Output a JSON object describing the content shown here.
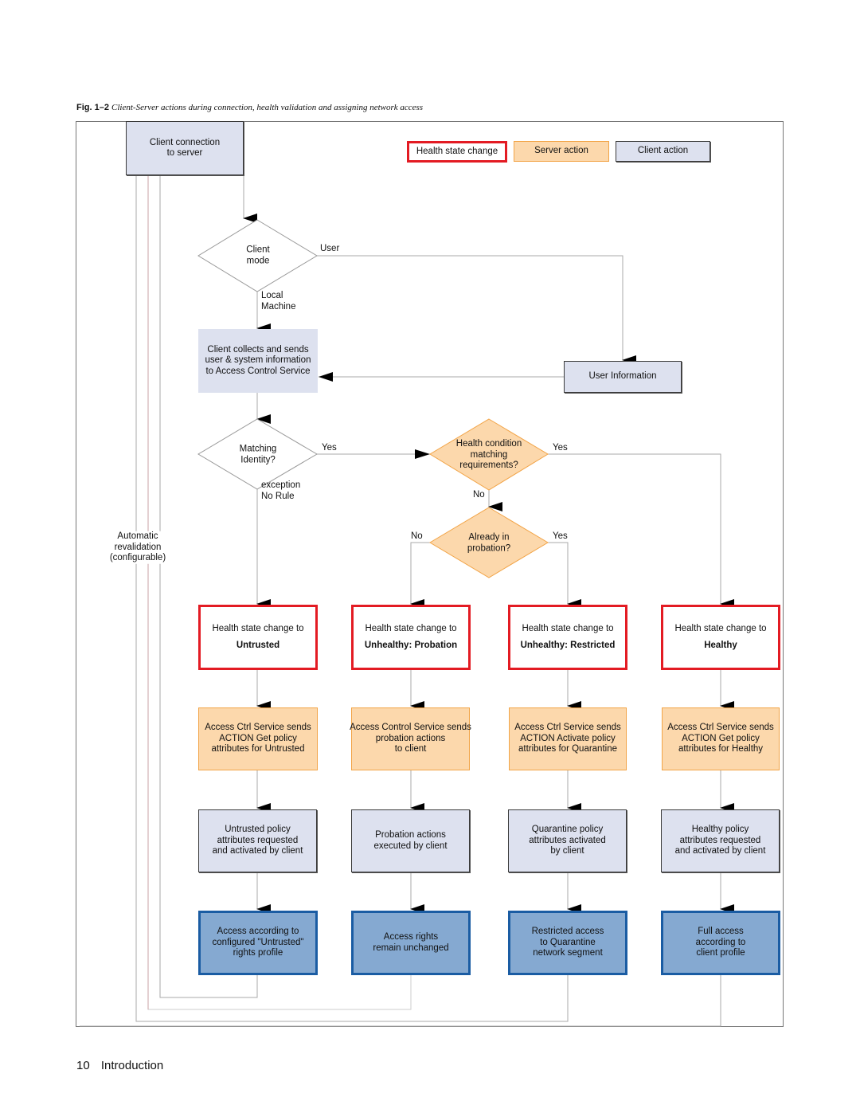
{
  "caption": {
    "figure": "Fig. 1–2",
    "text": "Client-Server actions during connection, health validation and assigning network access"
  },
  "legend": {
    "health_state_change": "Health state change",
    "server_action": "Server action",
    "client_action": "Client action"
  },
  "colors": {
    "health_border": "#e31b23",
    "server_fill": "#fcd8ac",
    "server_border": "#f2a447",
    "client_fill": "#dde1ef",
    "access_fill": "#85a9d1",
    "access_border": "#1a5ca3"
  },
  "nodes": {
    "start": "Client connection\nto server",
    "client_mode": "Client\nmode",
    "collects": "Client collects and sends\nuser & system information\nto Access Control Service",
    "user_info": "User Information",
    "matching_identity": "Matching\nIdentity?",
    "health_condition": "Health condition\nmatching\nrequirements?",
    "already_probation": "Already in\nprobation?",
    "auto_revalidation": "Automatic\nrevalidation\n(configurable)"
  },
  "edge_labels": {
    "user": "User",
    "local_machine": "Local\nMachine",
    "yes_identity": "Yes",
    "exception_no_rule": "exception\nNo Rule",
    "yes_health": "Yes",
    "no_health": "No",
    "no_probation": "No",
    "yes_probation": "Yes"
  },
  "columns": [
    {
      "health_prefix": "Health state change to",
      "health_state": "Untrusted",
      "server": "Access Ctrl Service sends\nACTION Get policy\nattributes for Untrusted",
      "client": "Untrusted policy\nattributes requested\nand activated by client",
      "access": "Access according to\nconfigured \"Untrusted\"\nrights profile"
    },
    {
      "health_prefix": "Health state change to",
      "health_state": "Unhealthy: Probation",
      "server": "Access Control Service sends\nprobation actions\nto client",
      "client": "Probation actions\nexecuted by client",
      "access": "Access rights\nremain unchanged"
    },
    {
      "health_prefix": "Health state change to",
      "health_state": "Unhealthy: Restricted",
      "server": "Access Ctrl Service sends\nACTION Activate policy\nattributes for Quarantine",
      "client": "Quarantine policy\nattributes activated\nby client",
      "access": "Restricted access\nto Quarantine\nnetwork segment"
    },
    {
      "health_prefix": "Health state change to",
      "health_state": "Healthy",
      "server": "Access Ctrl Service sends\nACTION Get policy\nattributes for Healthy",
      "client": "Healthy policy\nattributes requested\nand activated by client",
      "access": "Full access\naccording to\nclient profile"
    }
  ],
  "footer": {
    "page_number": "10",
    "section": "Introduction"
  }
}
